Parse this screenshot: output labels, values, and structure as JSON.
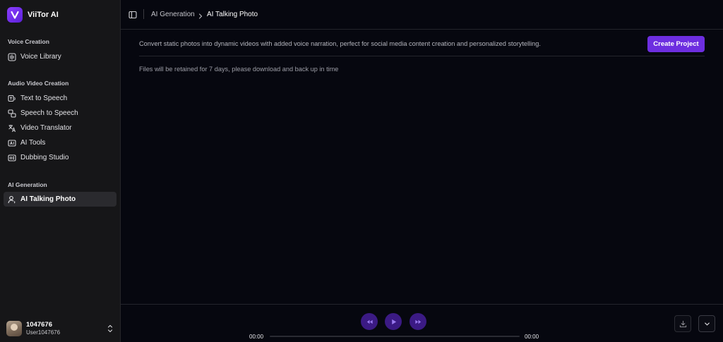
{
  "app": {
    "name": "ViiTor AI",
    "logo_letter": "V"
  },
  "sidebar": {
    "sections": [
      {
        "label": "Voice Creation"
      },
      {
        "label": "Audio Video Creation"
      },
      {
        "label": "AI Generation"
      }
    ],
    "items": [
      {
        "label": "Voice Library",
        "icon": "voice-library-icon"
      },
      {
        "label": "Text to Speech",
        "icon": "text-to-speech-icon"
      },
      {
        "label": "Speech to Speech",
        "icon": "speech-to-speech-icon"
      },
      {
        "label": "Video Translator",
        "icon": "video-translator-icon"
      },
      {
        "label": "AI Tools",
        "icon": "ai-tools-icon"
      },
      {
        "label": "Dubbing Studio",
        "icon": "dubbing-studio-icon"
      },
      {
        "label": "AI Talking Photo",
        "icon": "talking-photo-icon",
        "active": true
      }
    ],
    "user": {
      "name": "1047676",
      "handle": "User1047676"
    }
  },
  "breadcrumb": {
    "parent": "AI Generation",
    "current": "AI Talking Photo"
  },
  "main": {
    "description": "Convert static photos into dynamic videos with added voice narration, perfect for social media content creation and personalized storytelling.",
    "create_button": "Create Project",
    "notice": "Files will be retained for 7 days, please download and back up in time"
  },
  "player": {
    "current_time": "00:00",
    "total_time": "00:00",
    "progress": 0
  },
  "colors": {
    "accent": "#6d2ee0",
    "background": "#06070f",
    "sidebar": "#161618",
    "control": "#3b1a84"
  }
}
